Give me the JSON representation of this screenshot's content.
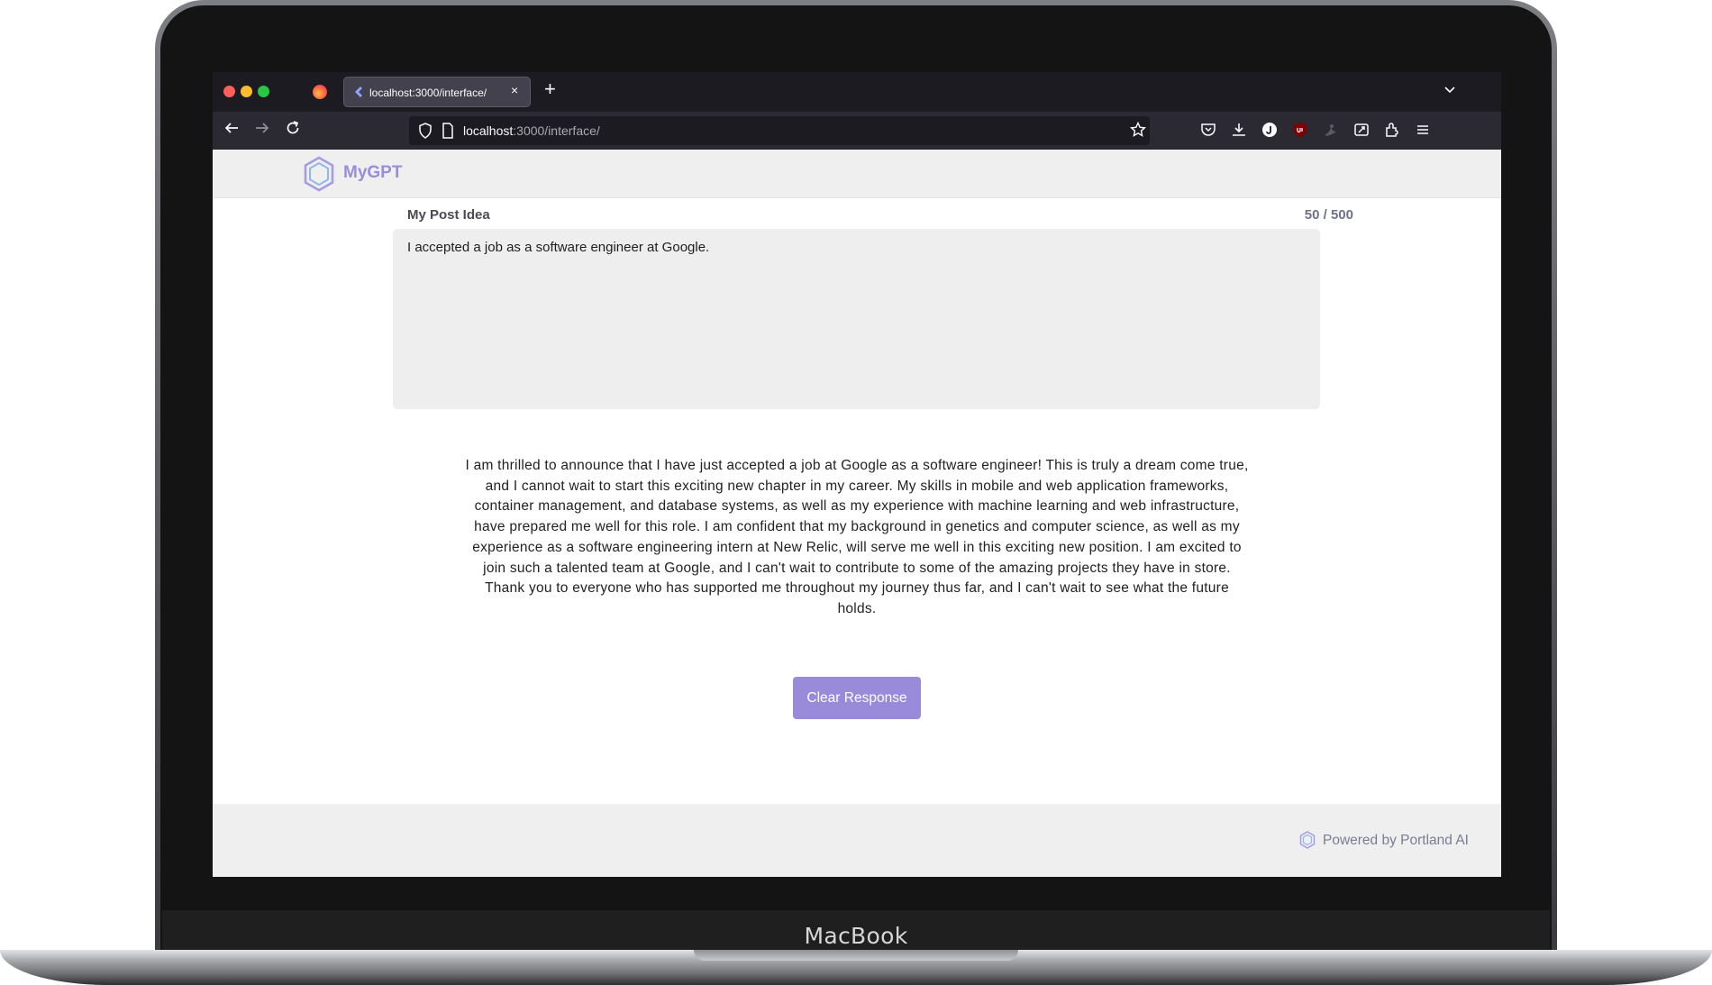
{
  "browser": {
    "tab_title": "localhost:3000/interface/",
    "tab_close_glyph": "×",
    "new_tab_glyph": "+",
    "url_host": "localhost",
    "url_path": ":3000/interface/",
    "nav_icons": [
      "back-arrow-icon",
      "forward-arrow-icon",
      "reload-icon"
    ],
    "toolbar_icons": [
      "pocket-icon",
      "download-icon",
      "extension-j-icon",
      "ublock-icon",
      "extension-bird-icon",
      "screenshot-icon",
      "extensions-icon",
      "menu-icon"
    ]
  },
  "app": {
    "logo_text": "MyGPT",
    "accent_color": "#998bd9"
  },
  "form": {
    "label": "My Post Idea",
    "char_count": "50 / 500",
    "input_value": "I accepted a job as a software engineer at Google."
  },
  "response": {
    "text": "I am thrilled to announce that I have just accepted a job at Google as a software engineer! This is truly a dream come true, and I cannot wait to start this exciting new chapter in my career. My skills in mobile and web application frameworks, container management, and database systems, as well as my experience with machine learning and web infrastructure, have prepared me well for this role. I am confident that my background in genetics and computer science, as well as my experience as a software engineering intern at New Relic, will serve me well in this exciting new position. I am excited to join such a talented team at Google, and I can't wait to contribute to some of the amazing projects they have in store. Thank you to everyone who has supported me throughout my journey thus far, and I can't wait to see what the future holds."
  },
  "actions": {
    "clear_label": "Clear Response"
  },
  "footer": {
    "text": "Powered by Portland AI"
  },
  "device": {
    "brand": "MacBook"
  }
}
